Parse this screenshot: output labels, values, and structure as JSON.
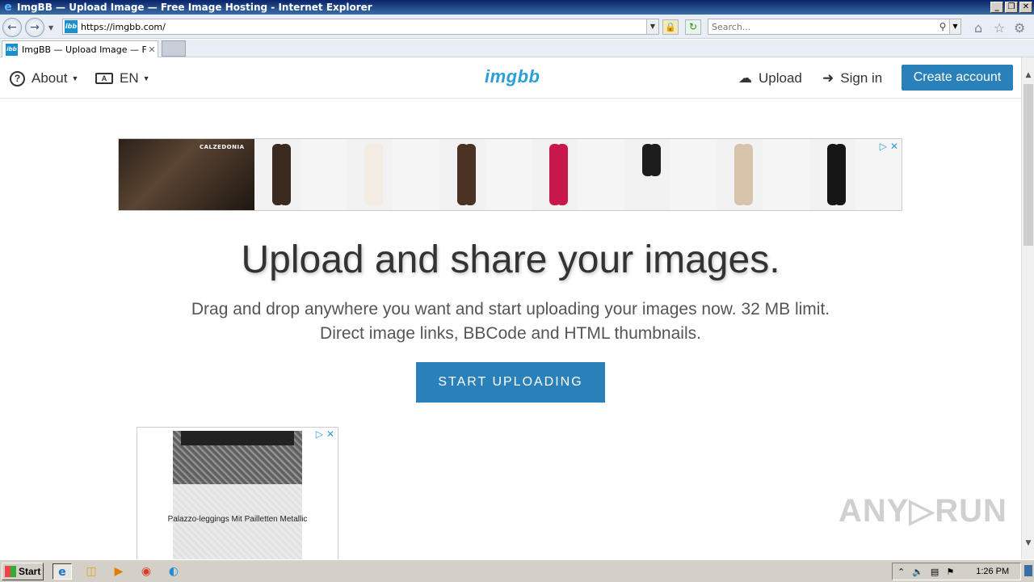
{
  "window": {
    "title": "ImgBB — Upload Image — Free Image Hosting - Internet Explorer",
    "controls": {
      "minimize": "_",
      "restore": "❐",
      "close": "✕"
    }
  },
  "browser": {
    "url": "https://imgbb.com/",
    "favicon_text": "ibb",
    "search_placeholder": "Search...",
    "tab_title": "ImgBB — Upload Image — Fr...",
    "icons": [
      "back-icon",
      "forward-icon",
      "lock-icon",
      "refresh-icon",
      "search-icon",
      "home-icon",
      "favorites-icon",
      "settings-icon"
    ]
  },
  "site": {
    "logo": "imgbb",
    "nav": {
      "about": "About",
      "language": "EN",
      "upload": "Upload",
      "sign_in": "Sign in",
      "create_account": "Create account"
    },
    "hero": {
      "title": "Upload and share your images.",
      "subtitle": "Drag and drop anywhere you want and start uploading your images now. 32 MB limit. Direct image links, BBCode and HTML thumbnails.",
      "cta": "START UPLOADING"
    },
    "ads": {
      "top_brand": "CALZEDONIA",
      "bottom_product": "Palazzo-leggings Mit Pailletten Metallic"
    },
    "watermark": "ANY▷RUN"
  },
  "taskbar": {
    "start": "Start",
    "time": "1:26 PM"
  },
  "colors": {
    "accent": "#2a80b9",
    "logo": "#2a9fd8"
  }
}
